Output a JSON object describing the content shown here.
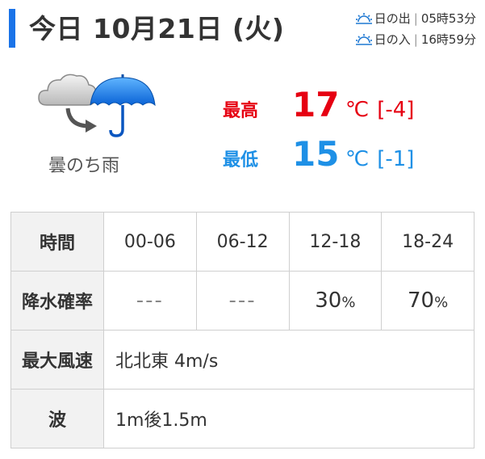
{
  "header": {
    "title": "今日 10月21日 (火)",
    "accent": "#1a73e8",
    "sunrise": {
      "icon": "sunrise-icon",
      "label": "日の出",
      "time": "05時53分"
    },
    "sunset": {
      "icon": "sunset-icon",
      "label": "日の入",
      "time": "16時59分"
    }
  },
  "weather": {
    "icon": "cloudy-then-rain-icon",
    "label": "曇のち雨"
  },
  "temperature": {
    "high": {
      "label": "最高",
      "value": "17",
      "unit": "℃",
      "diff": "[-4]",
      "color": "#e60012"
    },
    "low": {
      "label": "最低",
      "value": "15",
      "unit": "℃",
      "diff": "[-1]",
      "color": "#1e90e6"
    }
  },
  "table": {
    "time_header": "時間",
    "periods": [
      "00-06",
      "06-12",
      "12-18",
      "18-24"
    ],
    "precip_header": "降水確率",
    "precip": [
      {
        "value": "---",
        "unit": ""
      },
      {
        "value": "---",
        "unit": ""
      },
      {
        "value": "30",
        "unit": "%"
      },
      {
        "value": "70",
        "unit": "%"
      }
    ],
    "wind_header": "最大風速",
    "wind": "北北東 4m/s",
    "wave_header": "波",
    "wave": "1m後1.5m"
  }
}
